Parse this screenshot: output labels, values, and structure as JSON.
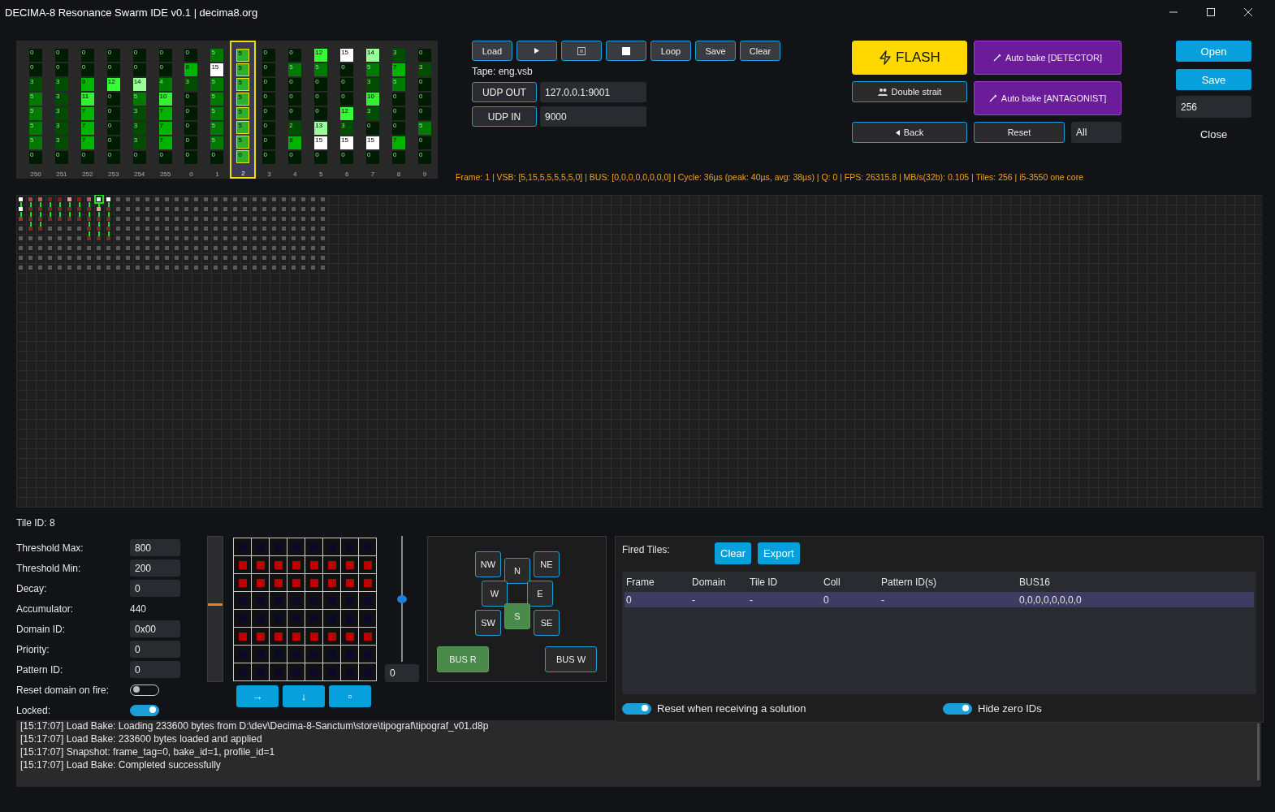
{
  "window": {
    "title": "DECIMA-8 Resonance Swarm IDE v0.1 | decima8.org"
  },
  "tile_columns": [
    {
      "label": "250",
      "selected": false,
      "cells": [
        "0",
        "0",
        "3",
        "5",
        "5",
        "5",
        "5",
        "0"
      ]
    },
    {
      "label": "251",
      "selected": false,
      "cells": [
        "0",
        "0",
        "3",
        "3",
        "3",
        "3",
        "3",
        "0"
      ]
    },
    {
      "label": "252",
      "selected": false,
      "cells": [
        "0",
        "0",
        "9",
        "11",
        "7",
        "7",
        "7",
        "0"
      ]
    },
    {
      "label": "253",
      "selected": false,
      "cells": [
        "0",
        "0",
        "12",
        "0",
        "0",
        "0",
        "0",
        "0"
      ]
    },
    {
      "label": "254",
      "selected": false,
      "cells": [
        "0",
        "0",
        "14",
        "5",
        "3",
        "3",
        "3",
        "0"
      ]
    },
    {
      "label": "255",
      "selected": false,
      "cells": [
        "0",
        "0",
        "4",
        "10",
        "7",
        "7",
        "7",
        "0"
      ]
    },
    {
      "label": "0",
      "selected": false,
      "cells": [
        "0",
        "8",
        "3",
        "0",
        "0",
        "0",
        "0",
        "0"
      ]
    },
    {
      "label": "1",
      "selected": false,
      "cells": [
        "5",
        "15",
        "5",
        "5",
        "5",
        "5",
        "5",
        "0"
      ]
    },
    {
      "label": "2",
      "selected": true,
      "cells": [
        "5",
        "5",
        "5",
        "5",
        "5",
        "5",
        "5",
        "0"
      ]
    },
    {
      "label": "3",
      "selected": false,
      "cells": [
        "0",
        "0",
        "0",
        "0",
        "0",
        "0",
        "0",
        "0"
      ]
    },
    {
      "label": "4",
      "selected": false,
      "cells": [
        "0",
        "5",
        "0",
        "0",
        "0",
        "2",
        "8",
        "0"
      ]
    },
    {
      "label": "5",
      "selected": false,
      "cells": [
        "12",
        "5",
        "0",
        "0",
        "0",
        "13",
        "15",
        "0"
      ]
    },
    {
      "label": "6",
      "selected": false,
      "cells": [
        "15",
        "0",
        "0",
        "0",
        "12",
        "3",
        "15",
        "0"
      ]
    },
    {
      "label": "7",
      "selected": false,
      "cells": [
        "14",
        "5",
        "3",
        "10",
        "3",
        "0",
        "15",
        "0"
      ]
    },
    {
      "label": "8",
      "selected": false,
      "cells": [
        "3",
        "7",
        "5",
        "0",
        "0",
        "0",
        "7",
        "0"
      ]
    },
    {
      "label": "9",
      "selected": false,
      "cells": [
        "0",
        "3",
        "0",
        "0",
        "0",
        "5",
        "0",
        "0"
      ]
    }
  ],
  "transport_buttons": [
    {
      "kind": "text",
      "label": "Load"
    },
    {
      "kind": "play"
    },
    {
      "kind": "pause"
    },
    {
      "kind": "stop"
    },
    {
      "kind": "text",
      "label": "Loop"
    },
    {
      "kind": "text",
      "label": "Save"
    },
    {
      "kind": "text",
      "label": "Clear"
    }
  ],
  "tape": "Tape: eng.vsb",
  "udp": [
    {
      "button": "UDP OUT",
      "value": "127.0.0.1:9001"
    },
    {
      "button": "UDP IN",
      "value": "9000"
    }
  ],
  "status_line": "Frame: 1 | VSB: [5,15,5,5,5,5,5,0] | BUS: [0,0,0,0,0,0,0,0] | Cycle: 36µs (peak: 40µs, avg: 38µs) | Q: 0 | FPS: 26315.8 | MB/s(32b): 0.105 | Tiles: 256 | i5-3550 one core",
  "actions": {
    "flash": "FLASH",
    "auto_bake_detector": "Auto bake [DETECTOR]",
    "double_strait": "Double strait",
    "auto_bake_antagonist": "Auto bake [ANTAGONIST]",
    "back": "Back",
    "reset": "Reset",
    "filter": "All"
  },
  "file_panel": {
    "open": "Open",
    "save": "Save",
    "count": "256",
    "close": "Close"
  },
  "tile_properties": {
    "tile_id": "Tile ID: 8",
    "rows": [
      {
        "kind": "field",
        "label": "Threshold Max:",
        "value": "800"
      },
      {
        "kind": "field",
        "label": "Threshold Min:",
        "value": "200"
      },
      {
        "kind": "field",
        "label": "Decay:",
        "value": "0"
      },
      {
        "kind": "text",
        "label": "Accumulator:",
        "value": "440"
      },
      {
        "kind": "field",
        "label": "Domain ID:",
        "value": "0x00"
      },
      {
        "kind": "field",
        "label": "Priority:",
        "value": "0"
      },
      {
        "kind": "field",
        "label": "Pattern ID:",
        "value": "0"
      },
      {
        "kind": "toggle",
        "label": "Reset domain on fire:",
        "on": false
      },
      {
        "kind": "toggle",
        "label": "Locked:",
        "on": true
      }
    ]
  },
  "level_meter": {
    "level": 0.52
  },
  "pattern_grid": [
    [
      false,
      false,
      false,
      false,
      false,
      false,
      false,
      false
    ],
    [
      true,
      true,
      true,
      true,
      true,
      true,
      true,
      true
    ],
    [
      true,
      true,
      true,
      true,
      true,
      true,
      true,
      true
    ],
    [
      false,
      false,
      false,
      false,
      false,
      false,
      false,
      false
    ],
    [
      false,
      false,
      false,
      false,
      false,
      false,
      false,
      false
    ],
    [
      true,
      true,
      true,
      true,
      true,
      true,
      true,
      true
    ],
    [
      false,
      false,
      false,
      false,
      false,
      false,
      false,
      false
    ],
    [
      false,
      false,
      false,
      false,
      false,
      false,
      false,
      false
    ]
  ],
  "pattern_buttons": [
    "→",
    "↓",
    "▫"
  ],
  "pattern_slider": {
    "level": 0.5,
    "value": "0"
  },
  "directions": [
    {
      "label": "NW",
      "selected": false
    },
    {
      "label": "N",
      "selected": false
    },
    {
      "label": "NE",
      "selected": false
    },
    {
      "label": "W",
      "selected": false
    },
    {
      "label": "E",
      "selected": false
    },
    {
      "label": "SW",
      "selected": false
    },
    {
      "label": "S",
      "selected": true
    },
    {
      "label": "SE",
      "selected": false
    }
  ],
  "bus_buttons": [
    {
      "label": "BUS R",
      "selected": true
    },
    {
      "label": "BUS W",
      "selected": false
    }
  ],
  "fired_tiles": {
    "title": "Fired Tiles:",
    "buttons": [
      "Clear",
      "Export"
    ],
    "columns": [
      "Frame",
      "Domain",
      "Tile ID",
      "Coll",
      "Pattern ID(s)",
      "BUS16"
    ],
    "rows": [
      {
        "selected": true,
        "cells": [
          "0",
          "-",
          "-",
          "0",
          "-",
          "0,0,0,0,0,0,0,0"
        ]
      }
    ],
    "toggles": [
      {
        "label": "Reset when receiving a solution",
        "on": true
      },
      {
        "label": "Hide zero IDs",
        "on": true
      }
    ]
  },
  "log": [
    "[15:17:07] Load Bake: Loading 233600 bytes from D:\\dev\\Decima-8-Sanctum\\store\\tipograf\\tipograf_v01.d8p",
    "[15:17:07] Load Bake: 233600 bytes loaded and applied",
    "[15:17:07] Snapshot: frame_tag=0, bake_id=1, profile_id=1",
    "[15:17:07] Load Bake: Completed successfully"
  ]
}
